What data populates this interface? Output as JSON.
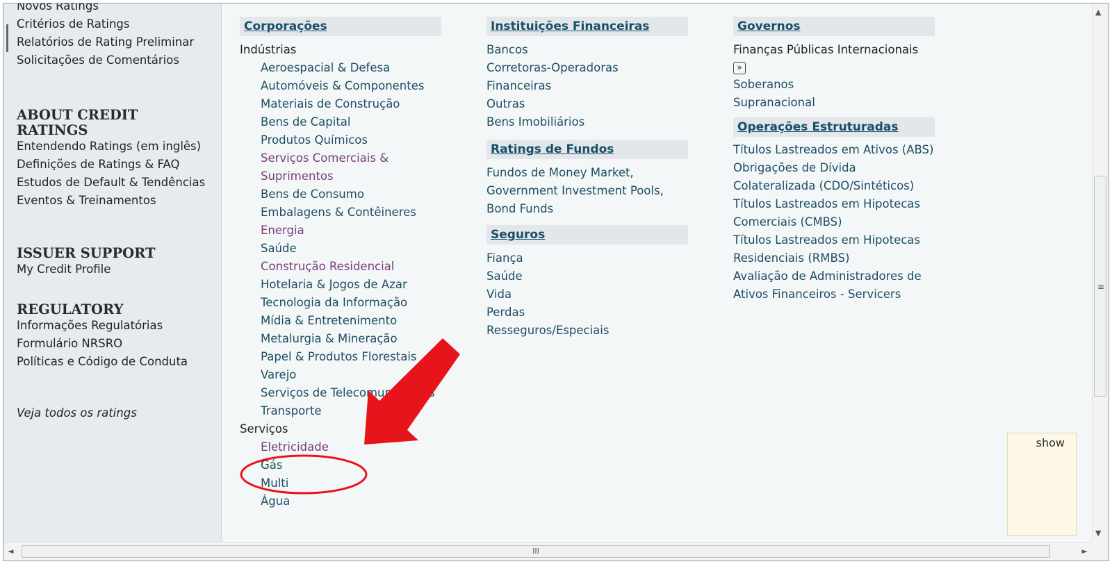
{
  "sidebar": {
    "top_items": [
      "Novos Ratings",
      "Critérios de Ratings",
      "Relatórios de Rating Preliminar",
      "Solicitações de Comentários"
    ],
    "about": {
      "heading": "ABOUT CREDIT RATINGS",
      "items": [
        "Entendendo Ratings (em inglês)",
        "Definições de Ratings & FAQ",
        "Estudos de Default & Tendências",
        "Eventos & Treinamentos"
      ]
    },
    "issuer": {
      "heading": "ISSUER SUPPORT",
      "items": [
        "My Credit Profile"
      ]
    },
    "regulatory": {
      "heading": "REGULATORY",
      "items": [
        "Informações Regulatórias",
        "Formulário NRSRO",
        "Políticas e Código de Conduta"
      ]
    },
    "see_all": "Veja todos os ratings"
  },
  "corporacoes": {
    "title": "Corporações",
    "industrias_label": "Indústrias",
    "industrias": [
      {
        "label": "Aeroespacial & Defesa",
        "visited": false
      },
      {
        "label": "Automóveis & Componentes",
        "visited": false
      },
      {
        "label": "Materiais de Construção",
        "visited": false
      },
      {
        "label": "Bens de Capital",
        "visited": false
      },
      {
        "label": "Produtos Químicos",
        "visited": false
      },
      {
        "label": "Serviços Comerciais & Suprimentos",
        "visited": true
      },
      {
        "label": "Bens de Consumo",
        "visited": false
      },
      {
        "label": "Embalagens & Contêineres",
        "visited": false
      },
      {
        "label": "Energia",
        "visited": true
      },
      {
        "label": "Saúde",
        "visited": false
      },
      {
        "label": "Construção Residencial",
        "visited": true
      },
      {
        "label": "Hotelaria & Jogos de Azar",
        "visited": false
      },
      {
        "label": "Tecnologia da Informação",
        "visited": false
      },
      {
        "label": "Mídia & Entretenimento",
        "visited": false
      },
      {
        "label": "Metalurgia & Mineração",
        "visited": false
      },
      {
        "label": "Papel & Produtos Florestais",
        "visited": false
      },
      {
        "label": "Varejo",
        "visited": false
      },
      {
        "label": "Serviços de Telecomunicações",
        "visited": false
      },
      {
        "label": "Transporte",
        "visited": false
      }
    ],
    "servicos_label": "Serviços",
    "servicos": [
      {
        "label": "Eletricidade",
        "visited": true
      },
      {
        "label": "Gás",
        "visited": false
      },
      {
        "label": "Multi",
        "visited": false
      },
      {
        "label": "Água",
        "visited": false
      }
    ]
  },
  "instituicoes": {
    "title": "Instituições Financeiras",
    "items": [
      "Bancos",
      "Corretoras-Operadoras",
      "Financeiras",
      "Outras",
      "Bens Imobiliários"
    ]
  },
  "fundos": {
    "title": "Ratings de Fundos",
    "text": "Fundos de Money Market, Government Investment Pools, Bond Funds"
  },
  "seguros": {
    "title": "Seguros",
    "items": [
      "Fiança",
      "Saúde",
      "Vida",
      "Perdas",
      "Resseguros/Especiais"
    ]
  },
  "governos": {
    "title": "Governos",
    "fpi_label": "Finanças Públicas Internacionais",
    "expander_glyph": "»",
    "items": [
      "Soberanos",
      "Supranacional"
    ]
  },
  "operacoes": {
    "title": "Operações Estruturadas",
    "items": [
      "Títulos Lastreados em Ativos (ABS)",
      "Obrigações de Dívida Colateralizada (CDO/Sintéticos)",
      "Títulos Lastreados em Hipotecas Comerciais (CMBS)",
      "Títulos Lastreados em Hipotecas Residenciais (RMBS)",
      "Avaliação de Administradores de Ativos Financeiros - Servicers"
    ]
  },
  "show_panel": {
    "label": "show"
  },
  "scrollbars": {
    "grip": "≡",
    "h_grip": "III",
    "up": "▲",
    "down": "▼",
    "left": "◄",
    "right": "►"
  },
  "colors": {
    "link": "#1d4d63",
    "visited": "#7a3a78",
    "header_bg": "#e3e7e9",
    "sidebar_bg": "#e6ebed",
    "annotation": "#e8141c"
  }
}
